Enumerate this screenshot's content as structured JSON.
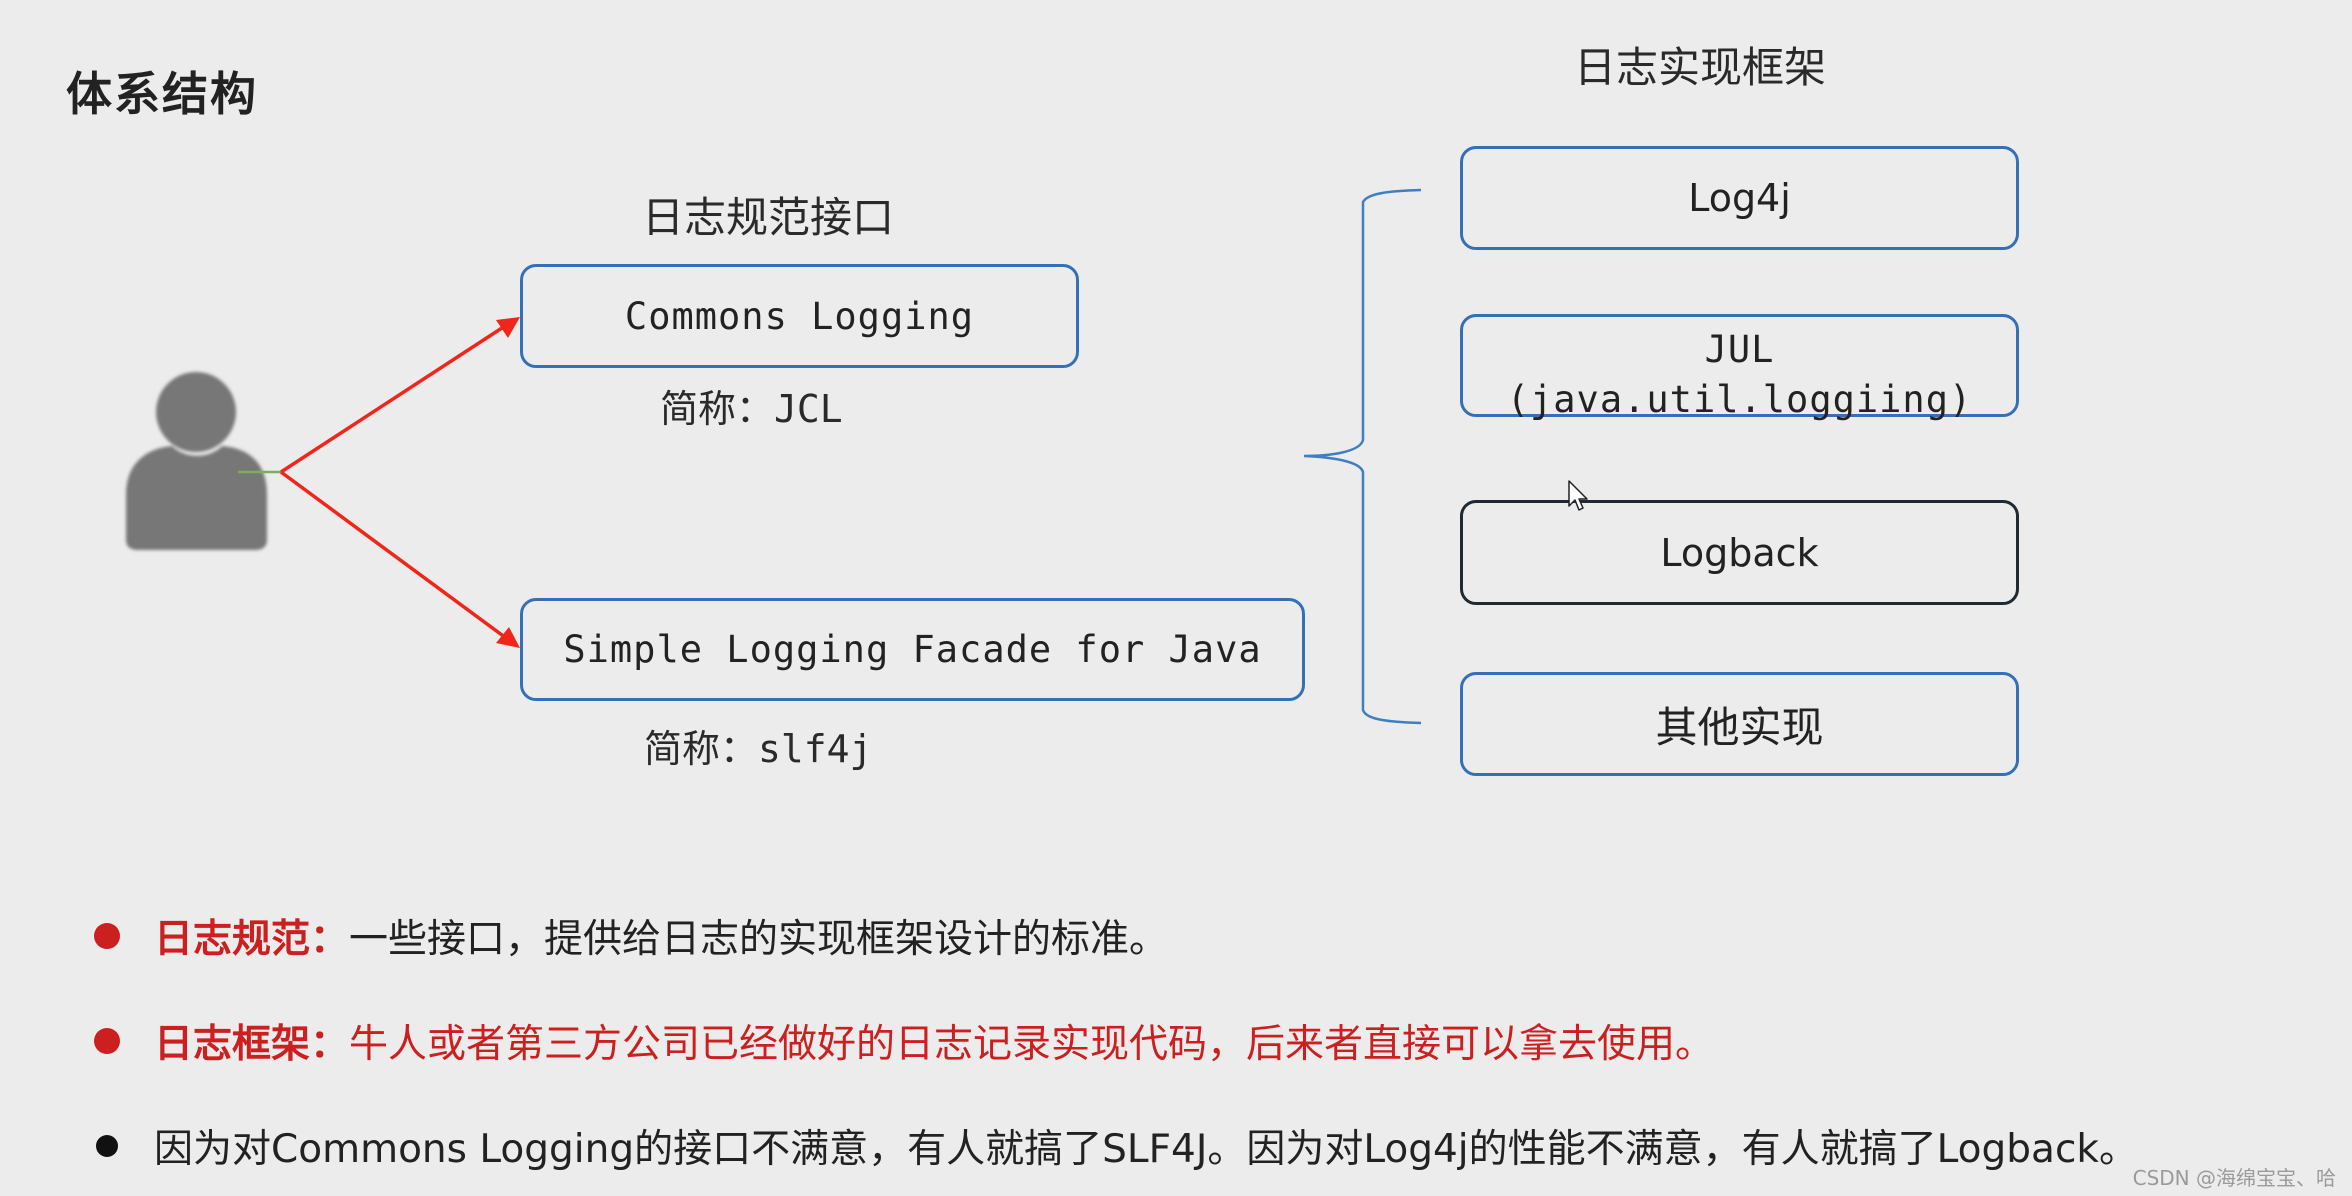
{
  "title": "体系结构",
  "colors": {
    "background": "#ececec",
    "box_border": "#3570b6",
    "box_border_active": "#1f2a33",
    "arrow": "#f0261a",
    "emphasis_red": "#cc1f1f",
    "text": "#222222",
    "person_icon": "#777777",
    "bracket": "#3f7ec0"
  },
  "spec": {
    "heading": "日志规范接口",
    "items": [
      {
        "name": "Commons Logging",
        "abbrev_label": "简称：",
        "abbrev_value": "JCL"
      },
      {
        "name": "Simple Logging Facade for Java",
        "abbrev_label": "简称：",
        "abbrev_value": "slf4j"
      }
    ]
  },
  "impl": {
    "heading": "日志实现框架",
    "items": [
      {
        "line1": "Log4j"
      },
      {
        "line1": "JUL",
        "line2": "(java.util.loggiing)"
      },
      {
        "line1": "Logback"
      },
      {
        "line1": "其他实现"
      }
    ]
  },
  "bullets": [
    {
      "term": "日志规范：",
      "text": "一些接口，提供给日志的实现框架设计的标准。",
      "dot_color": "#cc1f1f",
      "term_color": "#cc1f1f",
      "text_color": "#222222"
    },
    {
      "term": "日志框架：",
      "text": "牛人或者第三方公司已经做好的日志记录实现代码，后来者直接可以拿去使用。",
      "dot_color": "#cc1f1f",
      "term_color": "#cc1f1f",
      "text_color": "#cc1f1f"
    },
    {
      "term": "",
      "text": "因为对Commons Logging的接口不满意，有人就搞了SLF4J。因为对Log4j的性能不满意，有人就搞了Logback。",
      "dot_color": "#111111",
      "term_color": "#222222",
      "text_color": "#222222"
    }
  ],
  "watermark": "CSDN @海绵宝宝、哈"
}
